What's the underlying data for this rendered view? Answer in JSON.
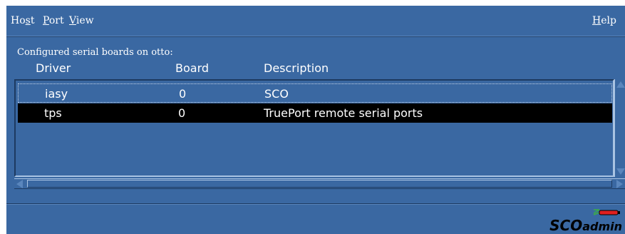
{
  "menubar": {
    "host": {
      "pre": "Ho",
      "mn": "s",
      "post": "t"
    },
    "port": {
      "pre": "",
      "mn": "P",
      "post": "ort"
    },
    "view": {
      "pre": "",
      "mn": "V",
      "post": "iew"
    },
    "help": {
      "pre": "",
      "mn": "H",
      "post": "elp"
    }
  },
  "main": {
    "heading": "Configured serial boards on otto:",
    "columns": {
      "driver": "Driver",
      "board": "Board",
      "description": "Description"
    },
    "rows": [
      {
        "driver": "iasy",
        "board": "0",
        "description": "SCO",
        "selected": false
      },
      {
        "driver": "tps",
        "board": "0",
        "description": "TruePort remote serial ports",
        "selected": true
      }
    ]
  },
  "logo": {
    "part1": "SCO",
    "part2": "admin"
  },
  "colors": {
    "background": "#3a68a2",
    "selection": "#000000",
    "text": "#ffffff",
    "logo_accent": "#e02020"
  },
  "icons": {
    "logo_mark": "connector-plug-icon"
  }
}
